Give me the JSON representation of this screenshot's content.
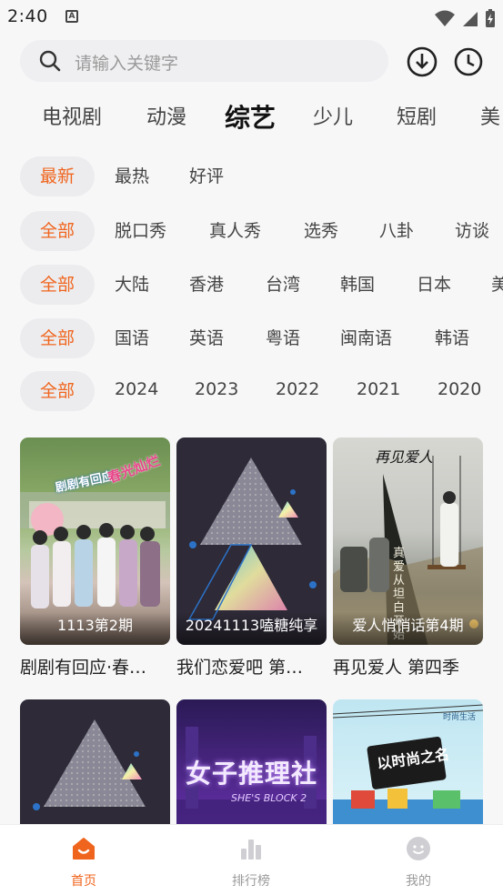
{
  "status_bar": {
    "time": "2:40",
    "notif_letter": "A"
  },
  "search": {
    "placeholder": "请输入关键字"
  },
  "category_tabs": [
    "电视剧",
    "动漫",
    "综艺",
    "少儿",
    "短剧",
    "美"
  ],
  "category_active": "综艺",
  "filters": {
    "sort": [
      "最新",
      "最热",
      "好评"
    ],
    "type": [
      "全部",
      "脱口秀",
      "真人秀",
      "选秀",
      "八卦",
      "访谈"
    ],
    "region": [
      "全部",
      "大陆",
      "香港",
      "台湾",
      "韩国",
      "日本",
      "美"
    ],
    "language": [
      "全部",
      "国语",
      "英语",
      "粤语",
      "闽南语",
      "韩语"
    ],
    "year": [
      "全部",
      "2024",
      "2023",
      "2022",
      "2021",
      "2020"
    ]
  },
  "cards": [
    {
      "caption": "1113第2期",
      "title": "剧剧有回应·春…",
      "poster": "variety-group-photo"
    },
    {
      "caption": "20241113嗑糖纯享",
      "title": "我们恋爱吧 第…",
      "poster": "placeholder-triangle"
    },
    {
      "caption": "爱人悄悄话第4期",
      "title": "再见爱人 第四季",
      "poster": "couple-swing-poster"
    },
    {
      "caption": "",
      "title": "",
      "poster": "placeholder-triangle"
    },
    {
      "caption": "",
      "title": "",
      "poster": "purple-mystery-poster"
    },
    {
      "caption": "",
      "title": "",
      "poster": "fashion-city-poster"
    }
  ],
  "poster_texts": {
    "card1_logo": "剧剧有回应",
    "card1_logo2": "春光灿烂",
    "card3_logo": "再见爱人",
    "card3_vertical": "真爱从坦白开始",
    "card5_logo": "女子推理社",
    "card5_sub": "SHE'S BLOCK 2",
    "card6_logo": "以时尚之名",
    "card6_tag": "时尚生活"
  },
  "bottom_nav": [
    {
      "label": "首页",
      "icon": "home-smile-icon",
      "active": true
    },
    {
      "label": "排行榜",
      "icon": "bar-chart-icon",
      "active": false
    },
    {
      "label": "我的",
      "icon": "profile-face-icon",
      "active": false
    }
  ],
  "colors": {
    "accent": "#f0651e",
    "background": "#f7f7f8",
    "chip_bg": "#ececee"
  }
}
